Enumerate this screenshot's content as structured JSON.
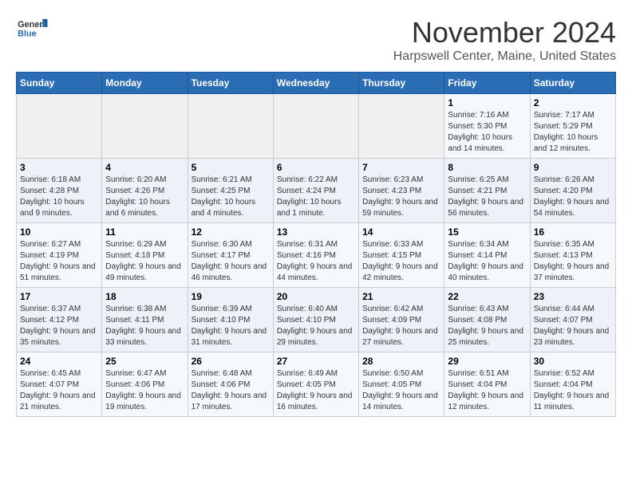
{
  "logo": {
    "line1": "General",
    "line2": "Blue"
  },
  "title": "November 2024",
  "subtitle": "Harpswell Center, Maine, United States",
  "days_of_week": [
    "Sunday",
    "Monday",
    "Tuesday",
    "Wednesday",
    "Thursday",
    "Friday",
    "Saturday"
  ],
  "weeks": [
    [
      {
        "day": "",
        "info": ""
      },
      {
        "day": "",
        "info": ""
      },
      {
        "day": "",
        "info": ""
      },
      {
        "day": "",
        "info": ""
      },
      {
        "day": "",
        "info": ""
      },
      {
        "day": "1",
        "info": "Sunrise: 7:16 AM\nSunset: 5:30 PM\nDaylight: 10 hours and 14 minutes."
      },
      {
        "day": "2",
        "info": "Sunrise: 7:17 AM\nSunset: 5:29 PM\nDaylight: 10 hours and 12 minutes."
      }
    ],
    [
      {
        "day": "3",
        "info": "Sunrise: 6:18 AM\nSunset: 4:28 PM\nDaylight: 10 hours and 9 minutes."
      },
      {
        "day": "4",
        "info": "Sunrise: 6:20 AM\nSunset: 4:26 PM\nDaylight: 10 hours and 6 minutes."
      },
      {
        "day": "5",
        "info": "Sunrise: 6:21 AM\nSunset: 4:25 PM\nDaylight: 10 hours and 4 minutes."
      },
      {
        "day": "6",
        "info": "Sunrise: 6:22 AM\nSunset: 4:24 PM\nDaylight: 10 hours and 1 minute."
      },
      {
        "day": "7",
        "info": "Sunrise: 6:23 AM\nSunset: 4:23 PM\nDaylight: 9 hours and 59 minutes."
      },
      {
        "day": "8",
        "info": "Sunrise: 6:25 AM\nSunset: 4:21 PM\nDaylight: 9 hours and 56 minutes."
      },
      {
        "day": "9",
        "info": "Sunrise: 6:26 AM\nSunset: 4:20 PM\nDaylight: 9 hours and 54 minutes."
      }
    ],
    [
      {
        "day": "10",
        "info": "Sunrise: 6:27 AM\nSunset: 4:19 PM\nDaylight: 9 hours and 51 minutes."
      },
      {
        "day": "11",
        "info": "Sunrise: 6:29 AM\nSunset: 4:18 PM\nDaylight: 9 hours and 49 minutes."
      },
      {
        "day": "12",
        "info": "Sunrise: 6:30 AM\nSunset: 4:17 PM\nDaylight: 9 hours and 46 minutes."
      },
      {
        "day": "13",
        "info": "Sunrise: 6:31 AM\nSunset: 4:16 PM\nDaylight: 9 hours and 44 minutes."
      },
      {
        "day": "14",
        "info": "Sunrise: 6:33 AM\nSunset: 4:15 PM\nDaylight: 9 hours and 42 minutes."
      },
      {
        "day": "15",
        "info": "Sunrise: 6:34 AM\nSunset: 4:14 PM\nDaylight: 9 hours and 40 minutes."
      },
      {
        "day": "16",
        "info": "Sunrise: 6:35 AM\nSunset: 4:13 PM\nDaylight: 9 hours and 37 minutes."
      }
    ],
    [
      {
        "day": "17",
        "info": "Sunrise: 6:37 AM\nSunset: 4:12 PM\nDaylight: 9 hours and 35 minutes."
      },
      {
        "day": "18",
        "info": "Sunrise: 6:38 AM\nSunset: 4:11 PM\nDaylight: 9 hours and 33 minutes."
      },
      {
        "day": "19",
        "info": "Sunrise: 6:39 AM\nSunset: 4:10 PM\nDaylight: 9 hours and 31 minutes."
      },
      {
        "day": "20",
        "info": "Sunrise: 6:40 AM\nSunset: 4:10 PM\nDaylight: 9 hours and 29 minutes."
      },
      {
        "day": "21",
        "info": "Sunrise: 6:42 AM\nSunset: 4:09 PM\nDaylight: 9 hours and 27 minutes."
      },
      {
        "day": "22",
        "info": "Sunrise: 6:43 AM\nSunset: 4:08 PM\nDaylight: 9 hours and 25 minutes."
      },
      {
        "day": "23",
        "info": "Sunrise: 6:44 AM\nSunset: 4:07 PM\nDaylight: 9 hours and 23 minutes."
      }
    ],
    [
      {
        "day": "24",
        "info": "Sunrise: 6:45 AM\nSunset: 4:07 PM\nDaylight: 9 hours and 21 minutes."
      },
      {
        "day": "25",
        "info": "Sunrise: 6:47 AM\nSunset: 4:06 PM\nDaylight: 9 hours and 19 minutes."
      },
      {
        "day": "26",
        "info": "Sunrise: 6:48 AM\nSunset: 4:06 PM\nDaylight: 9 hours and 17 minutes."
      },
      {
        "day": "27",
        "info": "Sunrise: 6:49 AM\nSunset: 4:05 PM\nDaylight: 9 hours and 16 minutes."
      },
      {
        "day": "28",
        "info": "Sunrise: 6:50 AM\nSunset: 4:05 PM\nDaylight: 9 hours and 14 minutes."
      },
      {
        "day": "29",
        "info": "Sunrise: 6:51 AM\nSunset: 4:04 PM\nDaylight: 9 hours and 12 minutes."
      },
      {
        "day": "30",
        "info": "Sunrise: 6:52 AM\nSunset: 4:04 PM\nDaylight: 9 hours and 11 minutes."
      }
    ]
  ]
}
